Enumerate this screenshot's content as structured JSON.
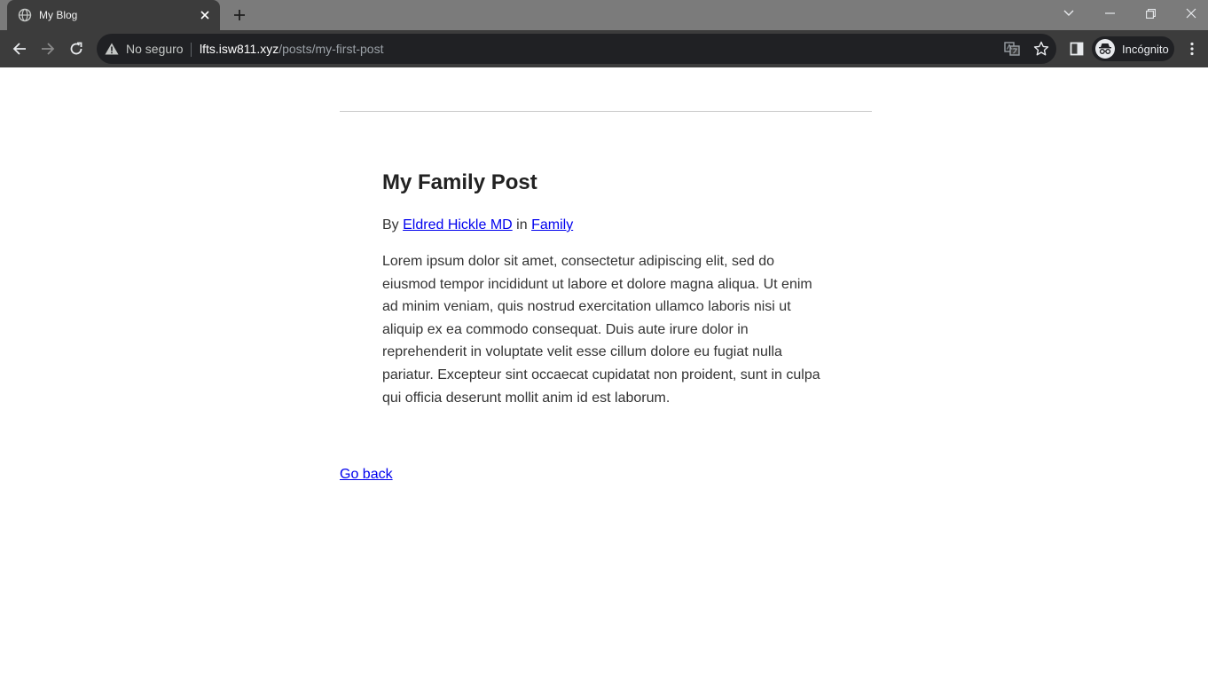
{
  "browser": {
    "tab": {
      "title": "My Blog"
    },
    "address_bar": {
      "security_status": "No seguro",
      "url_host": "lfts.isw811.xyz",
      "url_path": "/posts/my-first-post"
    },
    "profile": {
      "label": "Incógnito"
    }
  },
  "post": {
    "title": "My Family Post",
    "byline_prefix": "By",
    "author": "Eldred Hickle MD",
    "byline_in": "in",
    "category": "Family",
    "body": "Lorem ipsum dolor sit amet, consectetur adipiscing elit, sed do eiusmod tempor incididunt ut labore et dolore magna aliqua. Ut enim ad minim veniam, quis nostrud exercitation ullamco laboris nisi ut aliquip ex ea commodo consequat. Duis aute irure dolor in reprehenderit in voluptate velit esse cillum dolore eu fugiat nulla pariatur. Excepteur sint occaecat cupidatat non proident, sunt in culpa qui officia deserunt mollit anim id est laborum."
  },
  "nav": {
    "go_back": "Go back"
  },
  "colors": {
    "link": "#0000ee",
    "text": "#333333",
    "chrome_dark": "#3c3c3c",
    "tabstrip": "#7b7b7b"
  }
}
